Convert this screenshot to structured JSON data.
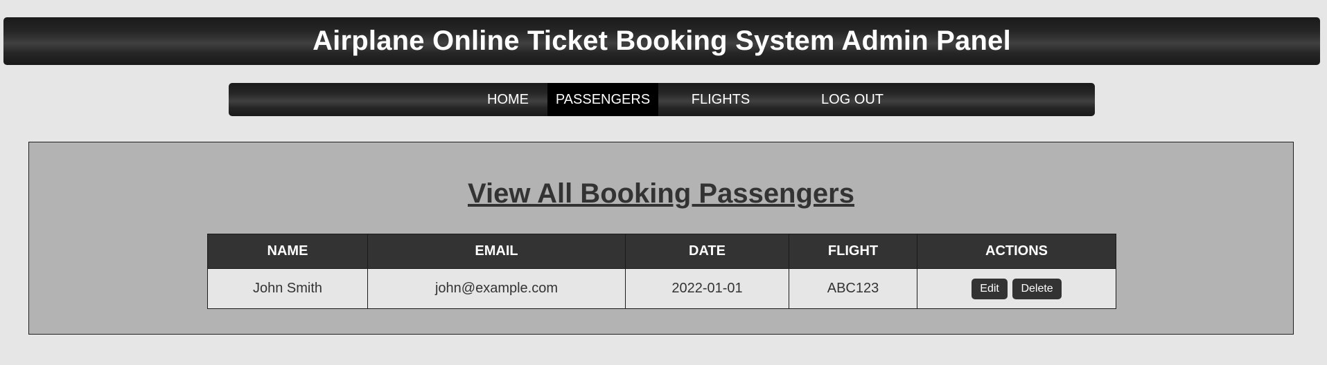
{
  "header": {
    "title": "Airplane Online Ticket Booking System Admin Panel"
  },
  "nav": {
    "items": [
      {
        "label": "HOME",
        "active": false
      },
      {
        "label": "PASSENGERS",
        "active": true
      },
      {
        "label": "FLIGHTS",
        "active": false
      },
      {
        "label": "LOG OUT",
        "active": false
      }
    ]
  },
  "main": {
    "heading": "View All Booking Passengers",
    "table": {
      "columns": [
        "NAME",
        "EMAIL",
        "DATE",
        "FLIGHT",
        "ACTIONS"
      ],
      "rows": [
        {
          "name": "John Smith",
          "email": "john@example.com",
          "date": "2022-01-01",
          "flight": "ABC123",
          "edit_label": "Edit",
          "delete_label": "Delete"
        }
      ]
    }
  },
  "colors": {
    "background": "#e6e6e6",
    "bar": "#262626",
    "active_nav": "#000000",
    "panel": "#b3b3b3",
    "table_header": "#333333",
    "heading_text": "#333333"
  }
}
